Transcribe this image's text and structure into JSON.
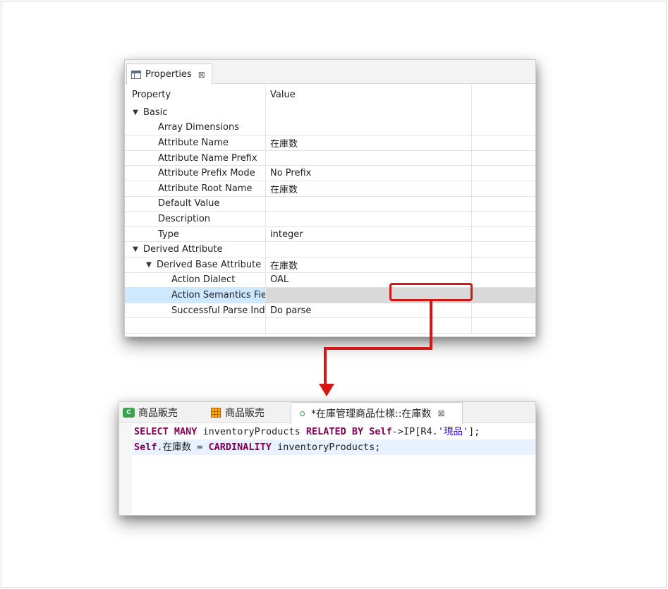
{
  "properties_panel": {
    "tab_label": "Properties",
    "close_glyph": "⊠",
    "columns": [
      "Property",
      "Value"
    ],
    "rows": [
      {
        "property": "Basic",
        "value": "",
        "expander": "expanded"
      },
      {
        "property": "Array Dimensions",
        "value": ""
      },
      {
        "property": "Attribute Name",
        "value": "在庫数"
      },
      {
        "property": "Attribute Name Prefix",
        "value": ""
      },
      {
        "property": "Attribute Prefix Mode",
        "value": "No Prefix"
      },
      {
        "property": "Attribute Root Name",
        "value": "在庫数"
      },
      {
        "property": "Default Value",
        "value": ""
      },
      {
        "property": "Description",
        "value": ""
      },
      {
        "property": "Type",
        "value": "integer"
      },
      {
        "property": "Derived Attribute",
        "value": "",
        "expander": "expanded"
      },
      {
        "property": "Derived Base Attribute",
        "value": "在庫数",
        "expander": "expanded"
      },
      {
        "property": "Action Dialect",
        "value": "OAL"
      },
      {
        "property": "Action Semantics Fiel",
        "value": "",
        "selected": true
      },
      {
        "property": "Successful Parse Indi",
        "value": "Do parse"
      }
    ]
  },
  "editor": {
    "tabs": [
      {
        "label": "商品販売",
        "icon": "class-icon"
      },
      {
        "label": "商品販売",
        "icon": "grid-icon"
      },
      {
        "label": "*在庫管理商品仕様::在庫数",
        "icon": "attribute-icon",
        "active": true
      }
    ],
    "close_glyph": "⊠",
    "code_line1": {
      "kw1": "SELECT MANY",
      "t1": " inventoryProducts ",
      "kw2": "RELATED BY",
      "t2": " ",
      "kw3": "Self",
      "t3": "->IP[R4.",
      "str": "'現品'",
      "t4": "];"
    },
    "code_line2": {
      "kw1": "Self",
      "t1": ".在庫数 = ",
      "kw2": "CARDINALITY",
      "t2": " inventoryProducts;"
    }
  },
  "colors": {
    "highlight": "#d41616",
    "keyword": "#7f0055",
    "string": "#2a00ff",
    "selection": "#cde8ff"
  }
}
